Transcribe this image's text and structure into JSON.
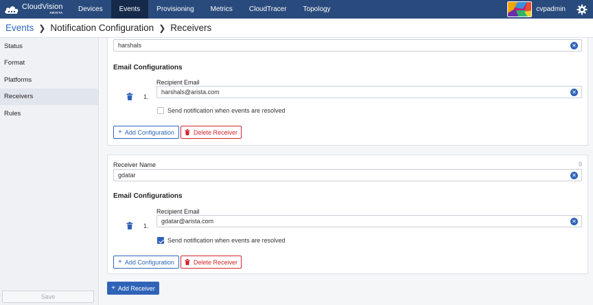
{
  "nav": {
    "brand_name": "CloudVision",
    "brand_sub": "ARISTA",
    "items": [
      {
        "label": "Devices",
        "active": false
      },
      {
        "label": "Events",
        "active": true
      },
      {
        "label": "Provisioning",
        "active": false
      },
      {
        "label": "Metrics",
        "active": false
      },
      {
        "label": "CloudTracer",
        "active": false
      },
      {
        "label": "Topology",
        "active": false
      }
    ],
    "username": "cvpadmin"
  },
  "breadcrumb": {
    "root": "Events",
    "middle": "Notification Configuration",
    "current": "Receivers"
  },
  "sidebar": {
    "items": [
      {
        "label": "Status"
      },
      {
        "label": "Format"
      },
      {
        "label": "Platforms"
      },
      {
        "label": "Receivers",
        "active": true
      },
      {
        "label": "Rules"
      }
    ],
    "save_label": "Save"
  },
  "receivers": [
    {
      "name_value": "harshals",
      "email_configurations_title": "Email Configurations",
      "configs": [
        {
          "index": "1.",
          "recipient_label": "Recipient Email",
          "email": "harshals@arista.com",
          "resolved_label": "Send notification when events are resolved",
          "resolved_checked": false
        }
      ],
      "add_config_label": "Add Configuration",
      "delete_label": "Delete Receiver"
    },
    {
      "name_label": "Receiver Name",
      "char_count": "9",
      "name_value": "gdatar",
      "email_configurations_title": "Email Configurations",
      "configs": [
        {
          "index": "1.",
          "recipient_label": "Recipient Email",
          "email": "gdatar@arista.com",
          "resolved_label": "Send notification when events are resolved",
          "resolved_checked": true
        }
      ],
      "add_config_label": "Add Configuration",
      "delete_label": "Delete Receiver"
    }
  ],
  "add_receiver_label": "Add Receiver",
  "colors": {
    "nav_bg": "#294a7c",
    "nav_active": "#15294a",
    "accent": "#2f63b8",
    "danger": "#d2232a"
  }
}
